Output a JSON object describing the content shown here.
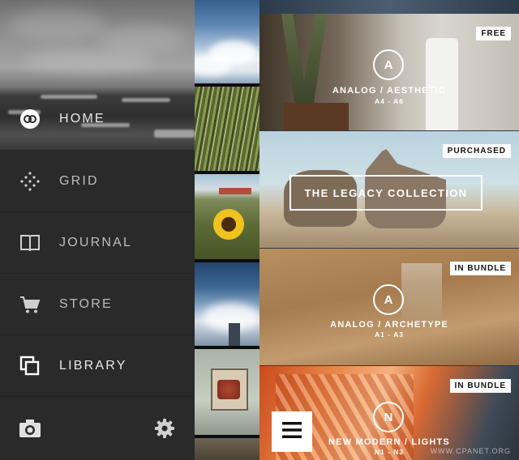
{
  "menu": {
    "items": [
      {
        "label": "HOME",
        "icon": "vsco-logo-icon"
      },
      {
        "label": "GRID",
        "icon": "grid-dots-icon"
      },
      {
        "label": "JOURNAL",
        "icon": "book-icon"
      },
      {
        "label": "STORE",
        "icon": "cart-icon"
      },
      {
        "label": "LIBRARY",
        "icon": "library-icon"
      }
    ],
    "bottom": {
      "camera_icon": "camera-icon",
      "settings_icon": "gear-icon"
    }
  },
  "store": {
    "cards": [
      {
        "badge": "FREE",
        "emblem": "A",
        "title": "ANALOG / AESTHETIC",
        "subtitle": "A4 - A6"
      },
      {
        "badge": "PURCHASED",
        "title": "THE LEGACY COLLECTION"
      },
      {
        "badge": "IN BUNDLE",
        "emblem": "A",
        "title": "ANALOG / ARCHETYPE",
        "subtitle": "A1 - A3"
      },
      {
        "badge": "IN BUNDLE",
        "emblem": "N",
        "title": "NEW MODERN / LIGHTS",
        "subtitle": "N1 - N3"
      }
    ]
  },
  "fab": {
    "icon": "hamburger-menu-icon"
  },
  "watermark": "WWW.CPANET.ORG"
}
